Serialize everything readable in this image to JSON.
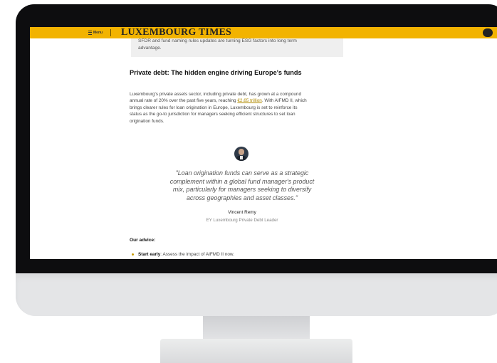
{
  "site": {
    "menu_label": "Menu",
    "brand": "LUXEMBOURG TIMES"
  },
  "article": {
    "prev_box": {
      "line1": "SFDR and fund naming rules updates are turning ESG factors into long term",
      "line2": "advantage."
    },
    "heading": "Private debt: The hidden engine driving Europe's funds",
    "paragraph": {
      "line1": "Luxembourg's private assets sector, including private debt, has grown at a compound",
      "line2_pre": "annual rate of 20% over the past five years, reaching ",
      "line2_link": "€2.65 trillion",
      "line2_post": ". With AIFMD II, which",
      "line3": "brings clearer rules for loan origination in Europe, Luxembourg is set to reinforce its",
      "line4": "status as the go-to jurisdiction for managers seeking efficient structures to set loan",
      "line5": "origination funds."
    },
    "quote": {
      "line1": "\"Loan origination funds can serve as a strategic",
      "line2": "complement within a global fund manager's product",
      "line3": "mix, particularly for managers seeking to diversify",
      "line4": "across geographies and asset classes.\"",
      "name": "Vincent Remy",
      "role": "EY Luxembourg Private Debt Leader"
    },
    "advice": {
      "title": "Our advice:",
      "item1_bold": "Start early",
      "item1_text": ": Assess the impact of AIFMD II now."
    }
  },
  "colors": {
    "topbar": "#f2b300",
    "link": "#b08a00"
  }
}
